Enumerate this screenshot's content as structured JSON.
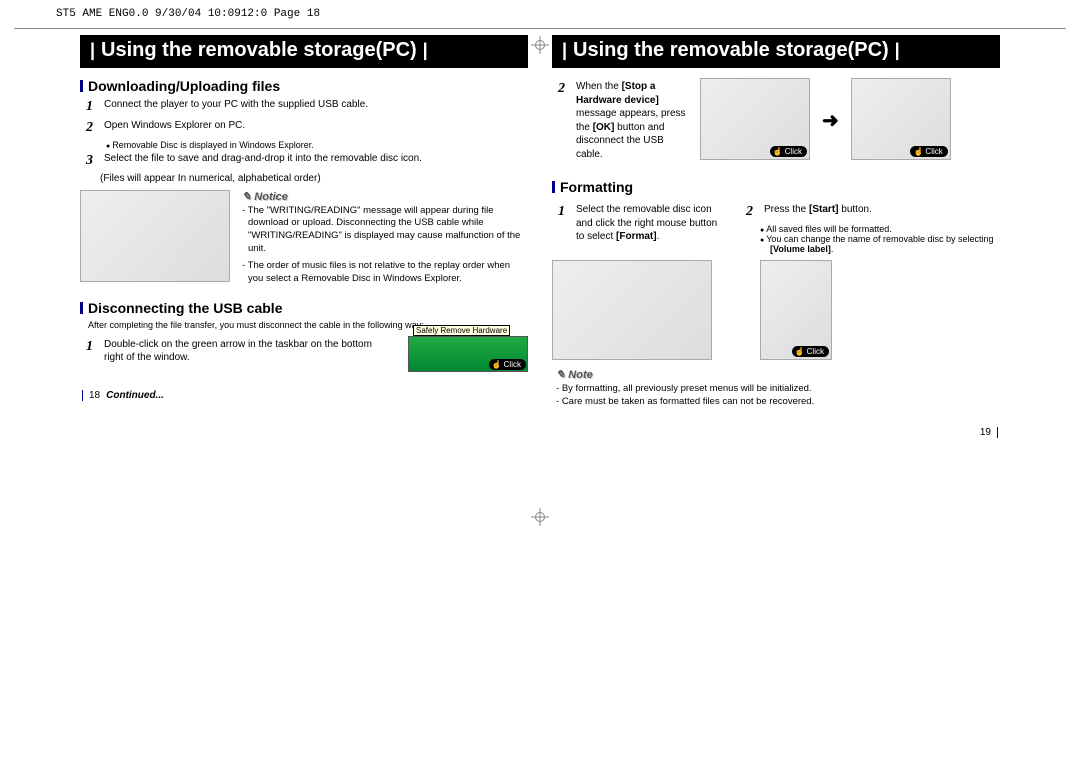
{
  "meta_header": "ST5 AME ENG0.0  9/30/04 10:0912:0  Page 18",
  "left": {
    "title": "Using the removable storage(PC)",
    "sec1": {
      "heading": "Downloading/Uploading files",
      "step1": "Connect the player to your PC with the supplied USB cable.",
      "step2": "Open Windows Explorer on PC.",
      "step2_sub": "Removable Disc is displayed in Windows Explorer.",
      "step3": "Select the file to save and drag-and-drop it into the removable disc icon.",
      "step3_sub": "(Files will appear In numerical, alphabetical order)",
      "notice_title": "Notice",
      "notice_a": "The \"WRITING/READING\" message will appear during file download or upload. Disconnecting the USB cable while \"WRITING/READING\" is displayed may cause malfunction of the unit.",
      "notice_b": "The order of music files is not relative to the replay order when you select a Removable Disc in Windows Explorer."
    },
    "sec2": {
      "heading": "Disconnecting the USB cable",
      "intro": "After completing the file transfer, you must disconnect the cable in the following way:",
      "step1": "Double-click on the green arrow in the taskbar on the bottom right of the window.",
      "tooltip": "Safely Remove Hardware",
      "click": "Click"
    },
    "page_no": "18",
    "continued": "Continued..."
  },
  "right": {
    "title": "Using the removable storage(PC)",
    "sec1": {
      "step2_a": "When the",
      "step2_bold": "[Stop a Hardware device]",
      "step2_b": "message appears, press the",
      "step2_ok": "[OK]",
      "step2_c": "button and disconnect the USB cable.",
      "click": "Click"
    },
    "sec2": {
      "heading": "Formatting",
      "step1_a": "Select the removable disc icon and click the right mouse button to select",
      "step1_bold": "[Format]",
      "step2_a": "Press the",
      "step2_bold": "[Start]",
      "step2_b": "button.",
      "bullet_a": "All saved files will be formatted.",
      "bullet_b": "You can change the name of removable disc by selecting",
      "bullet_b_bold": "[Volume label]",
      "click": "Click"
    },
    "note": {
      "title": "Note",
      "a": "By formatting, all previously preset menus will be initialized.",
      "b": "Care must be taken as formatted files can not be recovered."
    },
    "page_no": "19"
  }
}
